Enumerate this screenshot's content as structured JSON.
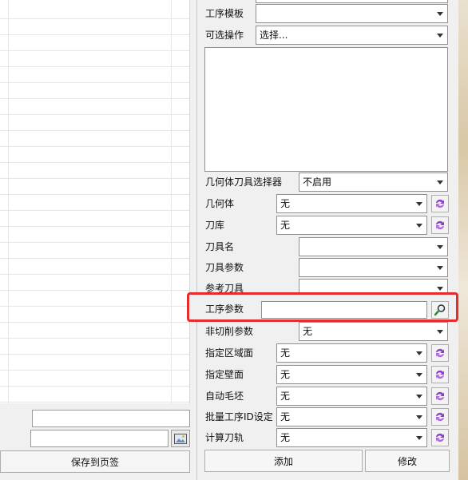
{
  "left": {
    "save_label": "保存到页签"
  },
  "panel": {
    "process_template": {
      "label": "工序模板",
      "value": ""
    },
    "optional_ops": {
      "label": "可选操作",
      "value": "选择..."
    },
    "geom_tool_selector": {
      "label": "几何体刀具选择器",
      "value": "不启用"
    },
    "geometry": {
      "label": "几何体",
      "value": "无"
    },
    "tool_library": {
      "label": "刀库",
      "value": "无"
    },
    "tool_name": {
      "label": "刀具名",
      "value": ""
    },
    "tool_params": {
      "label": "刀具参数",
      "value": ""
    },
    "ref_tool": {
      "label": "参考刀具",
      "value": ""
    },
    "process_params": {
      "label": "工序参数",
      "value": ""
    },
    "non_cut_params": {
      "label": "非切削参数",
      "value": "无"
    },
    "region_face": {
      "label": "指定区域面",
      "value": "无"
    },
    "wall_face": {
      "label": "指定壁面",
      "value": "无"
    },
    "auto_blank": {
      "label": "自动毛坯",
      "value": "无"
    },
    "batch_id": {
      "label": "批量工序ID设定",
      "value": "无"
    },
    "calc_toolpath": {
      "label": "计算刀轨",
      "value": "无"
    },
    "add_label": "添加",
    "modify_label": "修改"
  },
  "icons": {
    "refresh": "refresh-icon",
    "search": "search-icon",
    "image": "image-icon"
  },
  "colors": {
    "highlight": "#e52d2d",
    "refresh_icon": "#8e3bd1"
  }
}
